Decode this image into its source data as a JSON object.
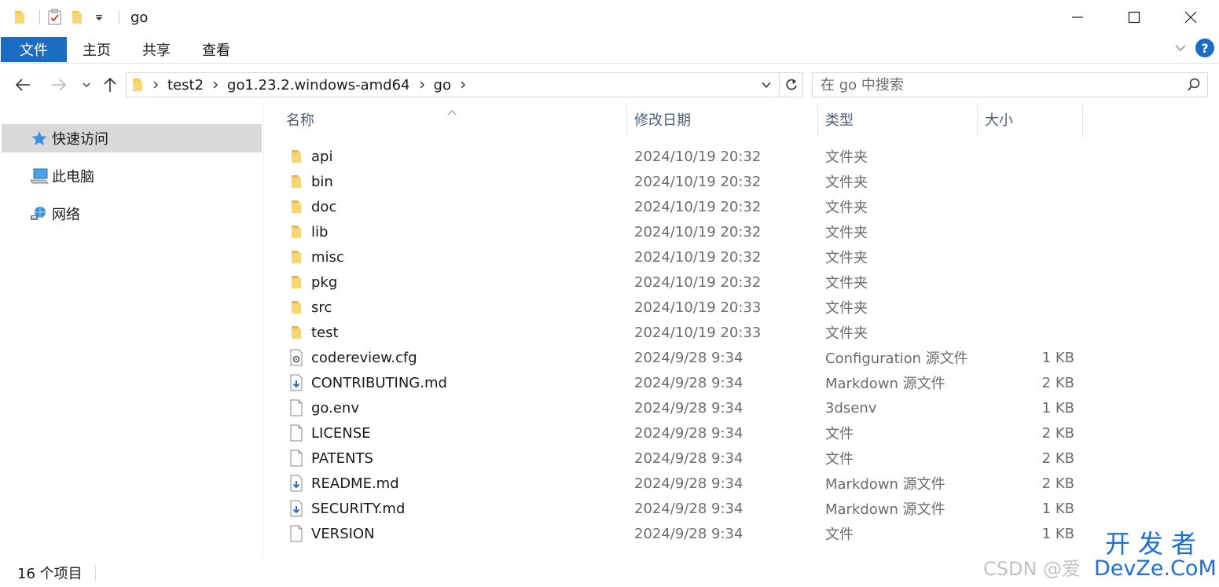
{
  "window": {
    "title": "go",
    "controls": [
      "minimize-icon",
      "maximize-icon",
      "close-icon"
    ]
  },
  "ribbon": {
    "tabs": [
      {
        "label": "文件",
        "active": true
      },
      {
        "label": "主页"
      },
      {
        "label": "共享"
      },
      {
        "label": "查看"
      }
    ],
    "help": "?"
  },
  "address": {
    "crumbs": [
      "test2",
      "go1.23.2.windows-amd64",
      "go"
    ]
  },
  "search": {
    "placeholder": "在 go 中搜索"
  },
  "nav": {
    "items": [
      {
        "label": "快速访问",
        "icon": "star-icon",
        "selected": true
      },
      {
        "label": "此电脑",
        "icon": "computer-icon"
      },
      {
        "label": "网络",
        "icon": "network-icon"
      }
    ]
  },
  "columns": {
    "name": "名称",
    "date": "修改日期",
    "type": "类型",
    "size": "大小"
  },
  "files": [
    {
      "name": "api",
      "date": "2024/10/19 20:32",
      "type": "文件夹",
      "size": "",
      "icon": "folder-icon"
    },
    {
      "name": "bin",
      "date": "2024/10/19 20:32",
      "type": "文件夹",
      "size": "",
      "icon": "folder-icon"
    },
    {
      "name": "doc",
      "date": "2024/10/19 20:32",
      "type": "文件夹",
      "size": "",
      "icon": "folder-icon"
    },
    {
      "name": "lib",
      "date": "2024/10/19 20:32",
      "type": "文件夹",
      "size": "",
      "icon": "folder-icon"
    },
    {
      "name": "misc",
      "date": "2024/10/19 20:32",
      "type": "文件夹",
      "size": "",
      "icon": "folder-icon"
    },
    {
      "name": "pkg",
      "date": "2024/10/19 20:32",
      "type": "文件夹",
      "size": "",
      "icon": "folder-icon"
    },
    {
      "name": "src",
      "date": "2024/10/19 20:33",
      "type": "文件夹",
      "size": "",
      "icon": "folder-icon"
    },
    {
      "name": "test",
      "date": "2024/10/19 20:33",
      "type": "文件夹",
      "size": "",
      "icon": "folder-icon"
    },
    {
      "name": "codereview.cfg",
      "date": "2024/9/28 9:34",
      "type": "Configuration 源文件",
      "size": "1 KB",
      "icon": "config-file-icon"
    },
    {
      "name": "CONTRIBUTING.md",
      "date": "2024/9/28 9:34",
      "type": "Markdown 源文件",
      "size": "2 KB",
      "icon": "markdown-file-icon"
    },
    {
      "name": "go.env",
      "date": "2024/9/28 9:34",
      "type": "3dsenv",
      "size": "1 KB",
      "icon": "file-icon"
    },
    {
      "name": "LICENSE",
      "date": "2024/9/28 9:34",
      "type": "文件",
      "size": "2 KB",
      "icon": "file-icon"
    },
    {
      "name": "PATENTS",
      "date": "2024/9/28 9:34",
      "type": "文件",
      "size": "2 KB",
      "icon": "file-icon"
    },
    {
      "name": "README.md",
      "date": "2024/9/28 9:34",
      "type": "Markdown 源文件",
      "size": "2 KB",
      "icon": "markdown-file-icon"
    },
    {
      "name": "SECURITY.md",
      "date": "2024/9/28 9:34",
      "type": "Markdown 源文件",
      "size": "1 KB",
      "icon": "markdown-file-icon"
    },
    {
      "name": "VERSION",
      "date": "2024/9/28 9:34",
      "type": "文件",
      "size": "1 KB",
      "icon": "file-icon"
    }
  ],
  "status": {
    "count": "16 个项目"
  },
  "watermark": {
    "csdn": "CSDN @爱",
    "brand_cn": "开发者",
    "brand_en": "DevZe.CoM"
  },
  "colors": {
    "accent": "#1a6dc2",
    "folder": "#f2c94c",
    "selected": "#d9d9d9",
    "header_text": "#4c607a",
    "secondary_text": "#6d6d6d"
  }
}
